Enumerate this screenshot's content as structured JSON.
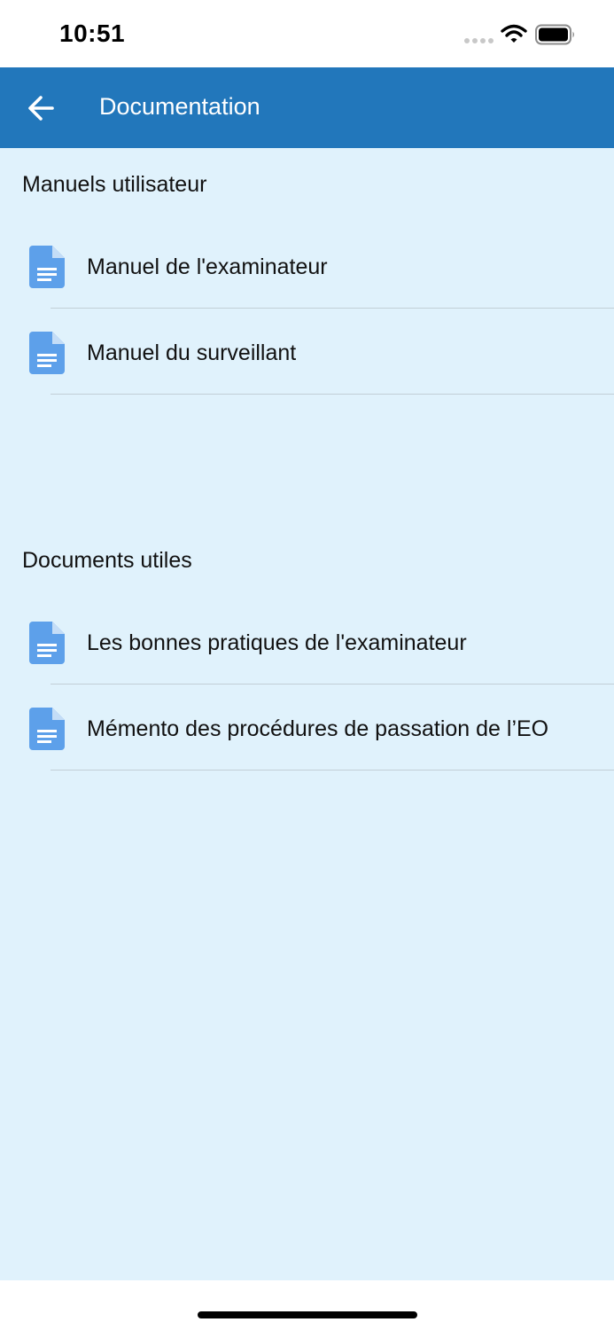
{
  "status_bar": {
    "time": "10:51"
  },
  "app_bar": {
    "title": "Documentation",
    "back_icon": "arrow-left-icon"
  },
  "colors": {
    "app_bar_background": "#2277bb",
    "content_background": "#e0f2fc",
    "doc_icon": "#5da0ea"
  },
  "sections": [
    {
      "title": "Manuels utilisateur",
      "items": [
        {
          "label": "Manuel de l'examinateur",
          "icon": "document-icon"
        },
        {
          "label": "Manuel du surveillant",
          "icon": "document-icon"
        }
      ]
    },
    {
      "title": "Documents utiles",
      "items": [
        {
          "label": "Les bonnes pratiques de l'examinateur",
          "icon": "document-icon"
        },
        {
          "label": "Mémento des procédures de passation de l’EO",
          "icon": "document-icon"
        }
      ]
    }
  ]
}
